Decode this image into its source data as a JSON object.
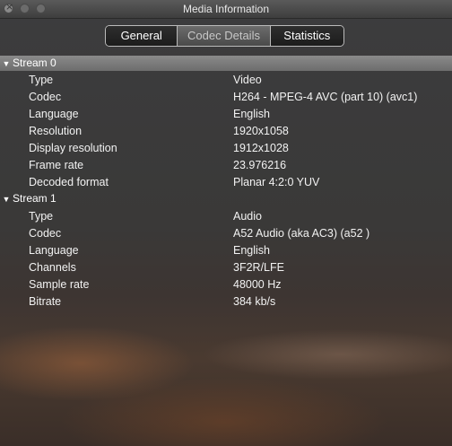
{
  "window": {
    "title": "Media Information"
  },
  "tabs": [
    {
      "label": "General",
      "active": false
    },
    {
      "label": "Codec Details",
      "active": true
    },
    {
      "label": "Statistics",
      "active": false
    }
  ],
  "streams": [
    {
      "label": "Stream 0",
      "rows": [
        {
          "key": "Type",
          "value": "Video"
        },
        {
          "key": "Codec",
          "value": "H264 - MPEG-4 AVC (part 10) (avc1)"
        },
        {
          "key": "Language",
          "value": "English"
        },
        {
          "key": "Resolution",
          "value": "1920x1058"
        },
        {
          "key": "Display resolution",
          "value": "1912x1028"
        },
        {
          "key": "Frame rate",
          "value": "23.976216"
        },
        {
          "key": "Decoded format",
          "value": "Planar 4:2:0 YUV"
        }
      ]
    },
    {
      "label": "Stream 1",
      "rows": [
        {
          "key": "Type",
          "value": "Audio"
        },
        {
          "key": "Codec",
          "value": "A52 Audio (aka AC3) (a52 )"
        },
        {
          "key": "Language",
          "value": "English"
        },
        {
          "key": "Channels",
          "value": "3F2R/LFE"
        },
        {
          "key": "Sample rate",
          "value": "48000 Hz"
        },
        {
          "key": "Bitrate",
          "value": "384 kb/s"
        }
      ]
    }
  ]
}
